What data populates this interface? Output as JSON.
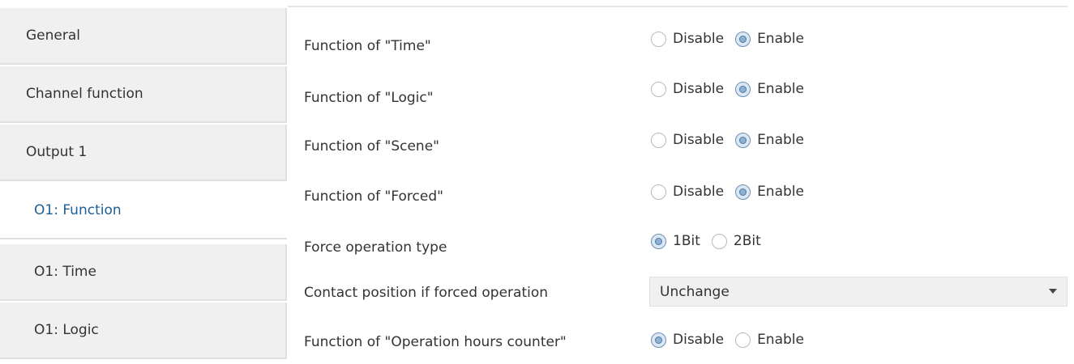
{
  "sidebar": {
    "items": [
      {
        "label": "General"
      },
      {
        "label": "Channel function"
      },
      {
        "label": "Output 1"
      },
      {
        "label": "O1: Function"
      },
      {
        "label": "O1: Time"
      },
      {
        "label": "O1: Logic"
      }
    ],
    "active": "O1: Function"
  },
  "params": [
    {
      "label": "Function of \"Time\"",
      "options": [
        "Disable",
        "Enable"
      ],
      "selected": "Enable"
    },
    {
      "label": "Function of \"Logic\"",
      "options": [
        "Disable",
        "Enable"
      ],
      "selected": "Enable"
    },
    {
      "label": "Function of \"Scene\"",
      "options": [
        "Disable",
        "Enable"
      ],
      "selected": "Enable"
    },
    {
      "label": "Function of \"Forced\"",
      "options": [
        "Disable",
        "Enable"
      ],
      "selected": "Enable"
    },
    {
      "label": "Force operation type",
      "options": [
        "1Bit",
        "2Bit"
      ],
      "selected": "1Bit"
    },
    {
      "label": "Contact position if forced operation",
      "dropdown_value": "Unchange"
    },
    {
      "label": "Function of \"Operation hours counter\"",
      "options": [
        "Disable",
        "Enable"
      ],
      "selected": "Disable"
    }
  ],
  "colors": {
    "active_text": "#1d5f97",
    "sidebar_bg": "#f0f0f0"
  }
}
